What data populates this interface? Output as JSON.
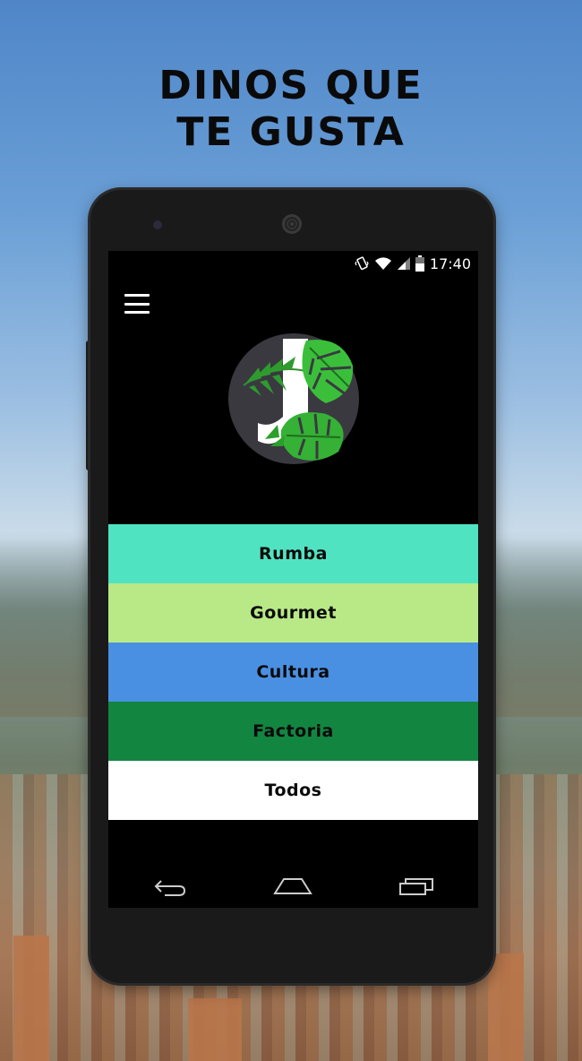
{
  "headline": {
    "line1": "DINOS QUE",
    "line2": "TE GUSTA"
  },
  "status_bar": {
    "time": "17:40",
    "icons": [
      "vibrate-icon",
      "wifi-icon",
      "signal-icon",
      "battery-icon"
    ]
  },
  "app_bar": {
    "menu_icon": "hamburger-menu-icon"
  },
  "logo": {
    "icon": "jungle-leaf-logo"
  },
  "menu": [
    {
      "label": "Rumba",
      "color": "#50e3c2"
    },
    {
      "label": "Gourmet",
      "color": "#b8e986"
    },
    {
      "label": "Cultura",
      "color": "#4a90e2"
    },
    {
      "label": "Factoria",
      "color": "#128641"
    },
    {
      "label": "Todos",
      "color": "#ffffff"
    }
  ],
  "nav_bar": {
    "icons": [
      "back-icon",
      "home-icon",
      "recents-icon"
    ]
  }
}
